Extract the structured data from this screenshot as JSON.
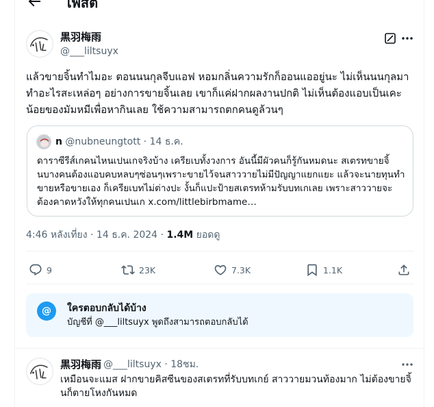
{
  "header": {
    "title": "โพสต์"
  },
  "post": {
    "display_name": "黒羽梅雨",
    "handle": "@___liltsuyx",
    "text": "แล้วขายจิ้นทำไมอะ ตอนนนกุลจีบแอฟ หอมกลิ่นความรักก็ออนแออยู่นะ ไม่เห็นนนกุลมาทำอะไรสะเหล่อๆ อย่างการขายจิ้นเลย เขาก็แค่ฝากผลงานปกติ ไม่เห็นต้องแอบเป็นเคะน้อยของมัมหมีเพื่อหากินเลย ใช้ความสามารถตกคนดูล้วนๆ",
    "quote": {
      "name": "n",
      "handle": "@nubneungtott",
      "date": "· 14 ธ.ค.",
      "text": "ดาราซีรีส์เกคนไหนเปนเกจริงบ้าง เครียเบทั้งวงการ อันนี้มีผัวคนก็รู้กันหมดนะ สเตรทขายจิ้นบางคนต้องแอบคบหลบๆซ่อนๆเพราะขายไว้จนสาววายไม่มีปัญญาแยกแยะ แล้วจะนายทุนทำขายหรือขายเอง ก็เครียเบทไม่ต่างปะ งั้นก็แปะป้ายสเตรทห้ามรับบทเกเลย เพราะสาววายจะต้องคาดหวังให้ทุกคนเปนเก x.com/littlebirbmame…"
    },
    "timestamp": "4:46 หลังเที่ยง · 14 ธ.ค. 2024 · ",
    "views_count": "1.4M",
    "views_label": " ยอดดู"
  },
  "actions": {
    "replies": "9",
    "reposts": "23K",
    "likes": "7.3K",
    "bookmarks": "1.1K"
  },
  "reply_restriction": {
    "title": "ใครตอบกลับได้บ้าง",
    "subtitle": "บัญชีที่ @___liltsuyx พูดถึงสามารถตอบกลับได้"
  },
  "reply": {
    "display_name": "黒羽梅雨",
    "handle_time": "@___liltsuyx · 18ชม.",
    "text": "เหมือนจะแมส ฝากขายคิสซีนของสเตรทที่รับบทเกย์ สาววายมวนท้องมาก ไม่ต้องขายจิ้นก็ตายโหงกันหมด"
  },
  "colors": {
    "accent": "#1d9bf0",
    "secondary_text": "#536471",
    "notice_bg": "#eff8fe"
  }
}
